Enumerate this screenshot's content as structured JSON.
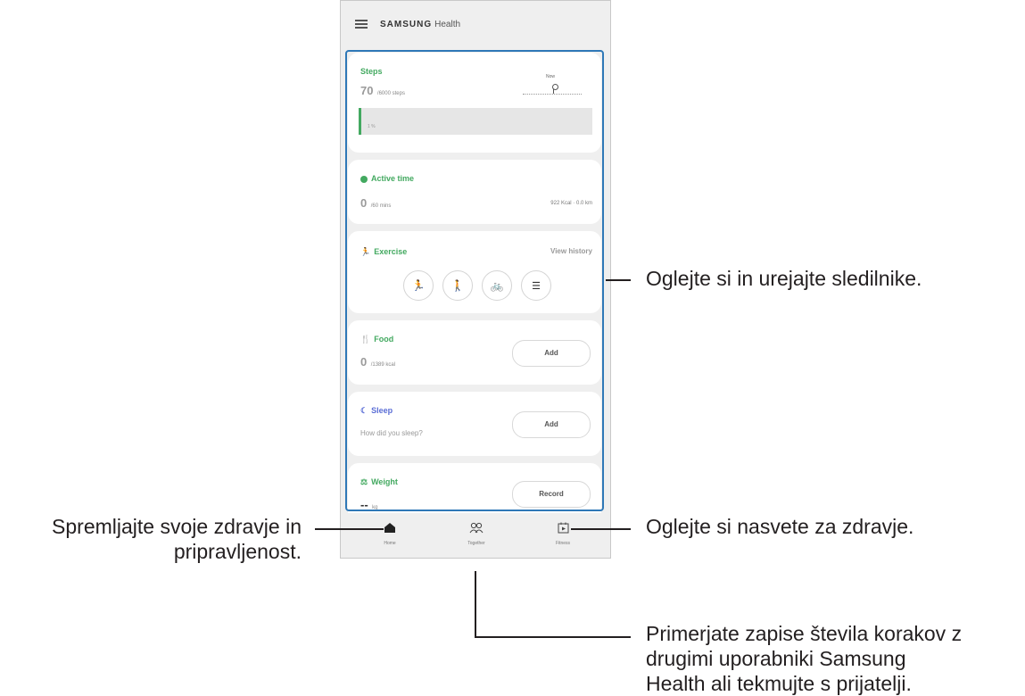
{
  "app": {
    "brand": "SAMSUNG",
    "title": "Health"
  },
  "steps": {
    "title": "Steps",
    "value": "70",
    "goal": "/6000 steps",
    "marker": "Now",
    "percent": "1 %"
  },
  "active_time": {
    "title": "Active time",
    "value": "0",
    "goal": "/60 mins",
    "kcal": "922 Kcal",
    "km": "0.0 km"
  },
  "exercise": {
    "title": "Exercise",
    "view_history": "View history"
  },
  "food": {
    "title": "Food",
    "value": "0",
    "goal": "/1389 kcal",
    "button": "Add"
  },
  "sleep": {
    "title": "Sleep",
    "prompt": "How did you sleep?",
    "button": "Add"
  },
  "weight": {
    "title": "Weight",
    "value": "--",
    "unit": "kg",
    "button": "Record"
  },
  "nav": {
    "home": "Home",
    "together": "Together",
    "fitness": "Fitness"
  },
  "callouts": {
    "trackers": "Oglejte si in urejajte sledilnike.",
    "home_line1": "Spremljajte svoje zdravje in",
    "home_line2": "pripravljenost.",
    "fitness": "Oglejte si nasvete za zdravje.",
    "together_line1": "Primerjate zapise števila korakov z",
    "together_line2": "drugimi uporabniki Samsung",
    "together_line3": "Health ali tekmujte s prijatelji."
  },
  "colors": {
    "accent": "#43a960",
    "highlight": "#2f78b7"
  }
}
